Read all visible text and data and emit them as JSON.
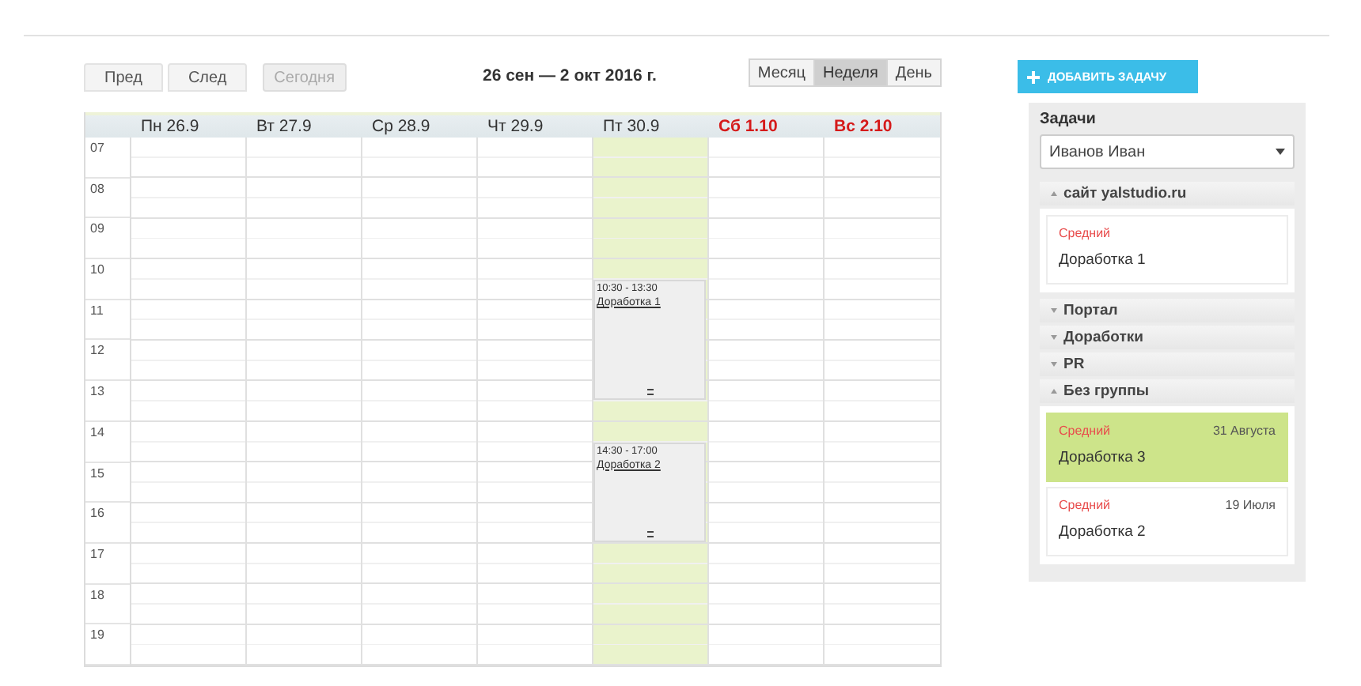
{
  "toolbar": {
    "nav_buttons": [
      {
        "label": "Пред",
        "disabled": false
      },
      {
        "label": "След",
        "disabled": false
      },
      {
        "label": "Сегодня",
        "disabled": true
      }
    ],
    "range_title": "26 сен — 2 окт 2016 г.",
    "view_tabs": [
      {
        "label": "Месяц",
        "selected": false
      },
      {
        "label": "Неделя",
        "selected": true
      },
      {
        "label": "День",
        "selected": false
      }
    ]
  },
  "days": [
    {
      "label": "Пн 26.9",
      "weekend": false,
      "today": false
    },
    {
      "label": "Вт 27.9",
      "weekend": false,
      "today": false
    },
    {
      "label": "Ср 28.9",
      "weekend": false,
      "today": false
    },
    {
      "label": "Чт 29.9",
      "weekend": false,
      "today": false
    },
    {
      "label": "Пт 30.9",
      "weekend": false,
      "today": true,
      "events": [
        {
          "time": "10:30 - 13:30",
          "title": "Доработка 1"
        },
        {
          "time": "14:30 - 17:00",
          "title": "Доработка 2"
        }
      ]
    },
    {
      "label": "Сб 1.10",
      "weekend": true,
      "today": false
    },
    {
      "label": "Вс 2.10",
      "weekend": true,
      "today": false
    }
  ],
  "hours": [
    "07",
    "08",
    "09",
    "10",
    "11",
    "12",
    "13",
    "14",
    "15",
    "16",
    "17",
    "18",
    "19"
  ],
  "sidebar": {
    "add_button": "ДОБАВИТЬ ЗАДАЧУ",
    "title": "Задачи",
    "assignee": "Иванов Иван",
    "groups": [
      {
        "name": "сайт yalstudio.ru",
        "expanded": true,
        "tasks": [
          {
            "priority": "Средний",
            "title": "Доработка 1",
            "selected": false
          }
        ]
      },
      {
        "name": "Портал",
        "expanded": false
      },
      {
        "name": "Доработки",
        "expanded": false
      },
      {
        "name": "PR",
        "expanded": false
      },
      {
        "name": "Без группы",
        "expanded": true,
        "tasks": [
          {
            "priority": "Средний",
            "date": "31 Августа",
            "title": "Доработка 3",
            "selected": true
          },
          {
            "priority": "Средний",
            "date": "19 Июля",
            "title": "Доработка 2",
            "selected": false
          }
        ]
      }
    ]
  }
}
